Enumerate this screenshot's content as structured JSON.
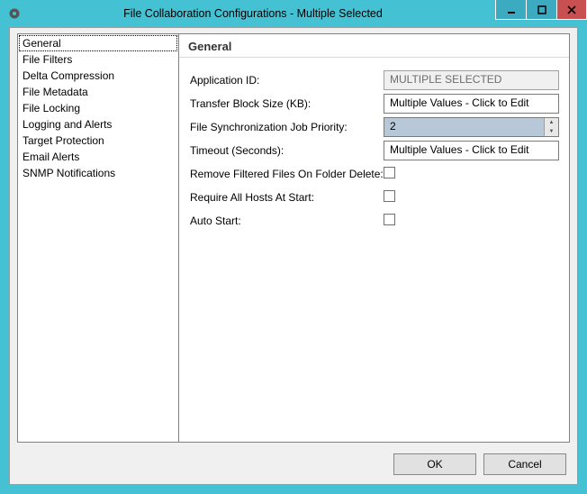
{
  "window": {
    "title": "File Collaboration Configurations - Multiple Selected"
  },
  "sidebar": {
    "items": [
      "General",
      "File Filters",
      "Delta Compression",
      "File Metadata",
      "File Locking",
      "Logging and Alerts",
      "Target Protection",
      "Email Alerts",
      "SNMP Notifications"
    ],
    "selectedIndex": 0
  },
  "panel": {
    "heading": "General",
    "fields": {
      "applicationId": {
        "label": "Application ID:",
        "value": "MULTIPLE SELECTED"
      },
      "transferBlockSize": {
        "label": "Transfer Block Size (KB):",
        "value": "Multiple Values - Click to Edit"
      },
      "syncPriority": {
        "label": "File Synchronization Job Priority:",
        "value": "2"
      },
      "timeout": {
        "label": "Timeout (Seconds):",
        "value": "Multiple Values - Click to Edit"
      },
      "removeFiltered": {
        "label": "Remove Filtered Files On Folder Delete:",
        "checked": false
      },
      "requireAllHosts": {
        "label": "Require All Hosts At Start:",
        "checked": false
      },
      "autoStart": {
        "label": "Auto Start:",
        "checked": false
      }
    }
  },
  "buttons": {
    "ok": "OK",
    "cancel": "Cancel"
  }
}
